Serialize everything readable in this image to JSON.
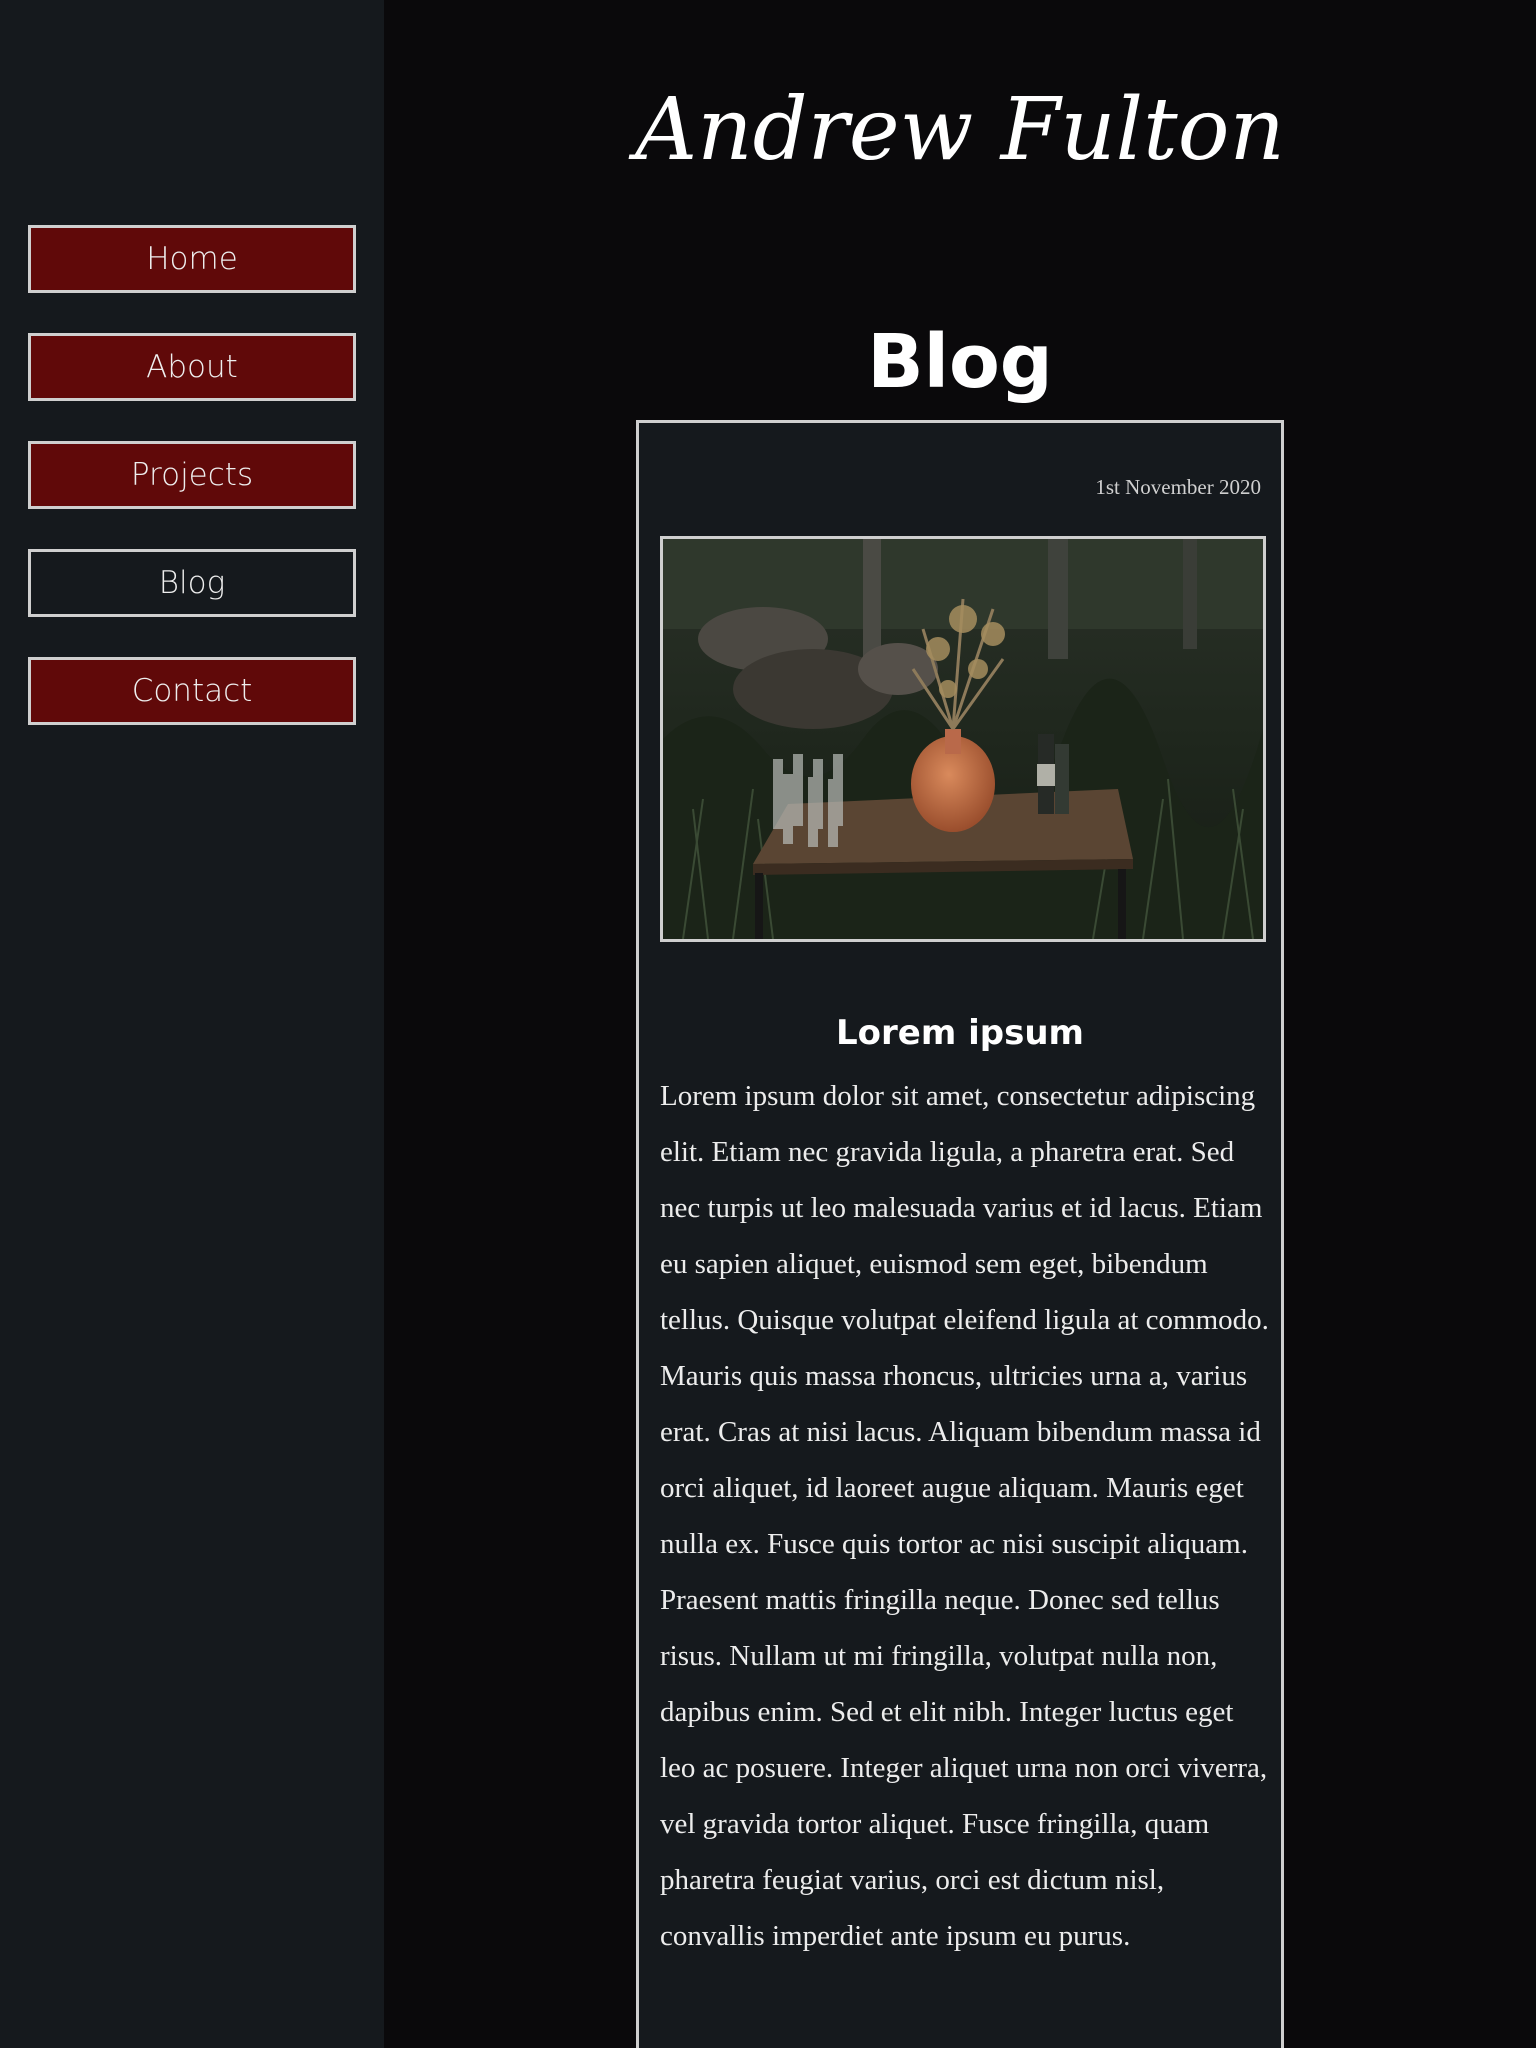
{
  "site": {
    "title": "Andrew Fulton"
  },
  "nav": {
    "items": [
      {
        "label": "Home",
        "active": false
      },
      {
        "label": "About",
        "active": false
      },
      {
        "label": "Projects",
        "active": false
      },
      {
        "label": "Blog",
        "active": true
      },
      {
        "label": "Contact",
        "active": false
      }
    ]
  },
  "page": {
    "title": "Blog"
  },
  "post": {
    "date": "1st November 2020",
    "image_name": "outdoor-table-photo",
    "heading": "Lorem ipsum",
    "body": "Lorem ipsum dolor sit amet, consectetur adipiscing elit. Etiam nec gravida ligula, a pharetra erat. Sed nec turpis ut leo malesuada varius et id lacus. Etiam eu sapien aliquet, euismod sem eget, bibendum tellus. Quisque volutpat eleifend ligula at commodo. Mauris quis massa rhoncus, ultricies urna a, varius erat. Cras at nisi lacus. Aliquam bibendum massa id orci aliquet, id laoreet augue aliquam. Mauris eget nulla ex. Fusce quis tortor ac nisi suscipit aliquam. Praesent mattis fringilla neque. Donec sed tellus risus. Nullam ut mi fringilla, volutpat nulla non, dapibus enim. Sed et elit nibh. Integer luctus eget leo ac posuere. Integer aliquet urna non orci viverra, vel gravida tortor aliquet. Fusce fringilla, quam pharetra feugiat varius, orci est dictum nisl, convallis imperdiet ante ipsum eu purus."
  },
  "colors": {
    "sidebar_bg": "#15191d",
    "main_bg": "#0a090b",
    "nav_button_bg": "#600909",
    "border": "#cfcfcf",
    "text": "#ffffff"
  }
}
